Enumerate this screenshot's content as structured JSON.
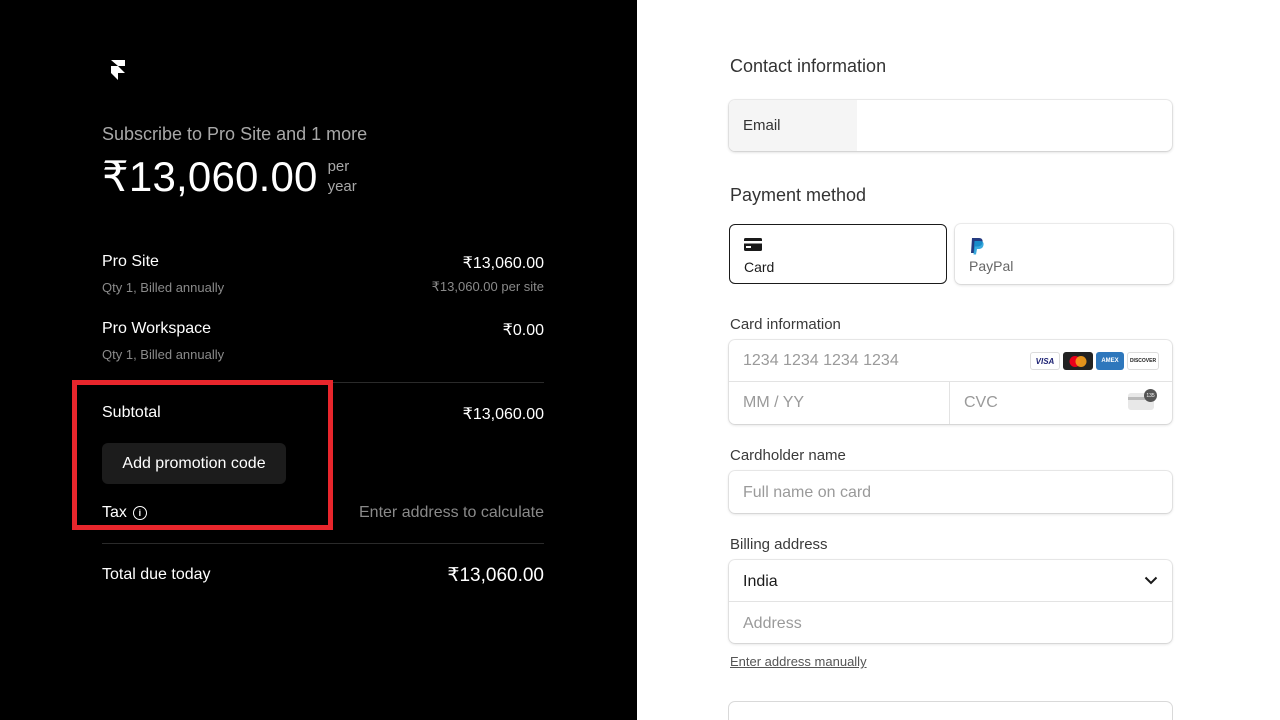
{
  "summary": {
    "subscribe_text": "Subscribe to Pro Site and 1 more",
    "price": "₹13,060.00",
    "per_label_1": "per",
    "per_label_2": "year",
    "items": [
      {
        "name": "Pro Site",
        "detail": "Qty 1, Billed annually",
        "amount": "₹13,060.00",
        "unit_price": "₹13,060.00 per site"
      },
      {
        "name": "Pro Workspace",
        "detail": "Qty 1, Billed annually",
        "amount": "₹0.00"
      }
    ],
    "subtotal_label": "Subtotal",
    "subtotal_amount": "₹13,060.00",
    "promo_button": "Add promotion code",
    "tax_label": "Tax",
    "tax_value": "Enter address to calculate",
    "total_label": "Total due today",
    "total_amount": "₹13,060.00"
  },
  "form": {
    "contact_title": "Contact information",
    "email_label": "Email",
    "payment_title": "Payment method",
    "methods": [
      {
        "label": "Card",
        "selected": true
      },
      {
        "label": "PayPal",
        "selected": false
      }
    ],
    "card_info_label": "Card information",
    "card_number_placeholder": "1234 1234 1234 1234",
    "expiry_placeholder": "MM / YY",
    "cvc_placeholder": "CVC",
    "card_brands": [
      "VISA",
      "mastercard",
      "amex",
      "DISCOVER"
    ],
    "cvc_badge": "135",
    "cardholder_label": "Cardholder name",
    "cardholder_placeholder": "Full name on card",
    "billing_label": "Billing address",
    "country": "India",
    "address_placeholder": "Address",
    "manual_link": "Enter address manually"
  },
  "colors": {
    "left_background": "#000000",
    "highlight_border": "#e8262c",
    "promo_button_bg": "#1c1c1c"
  }
}
